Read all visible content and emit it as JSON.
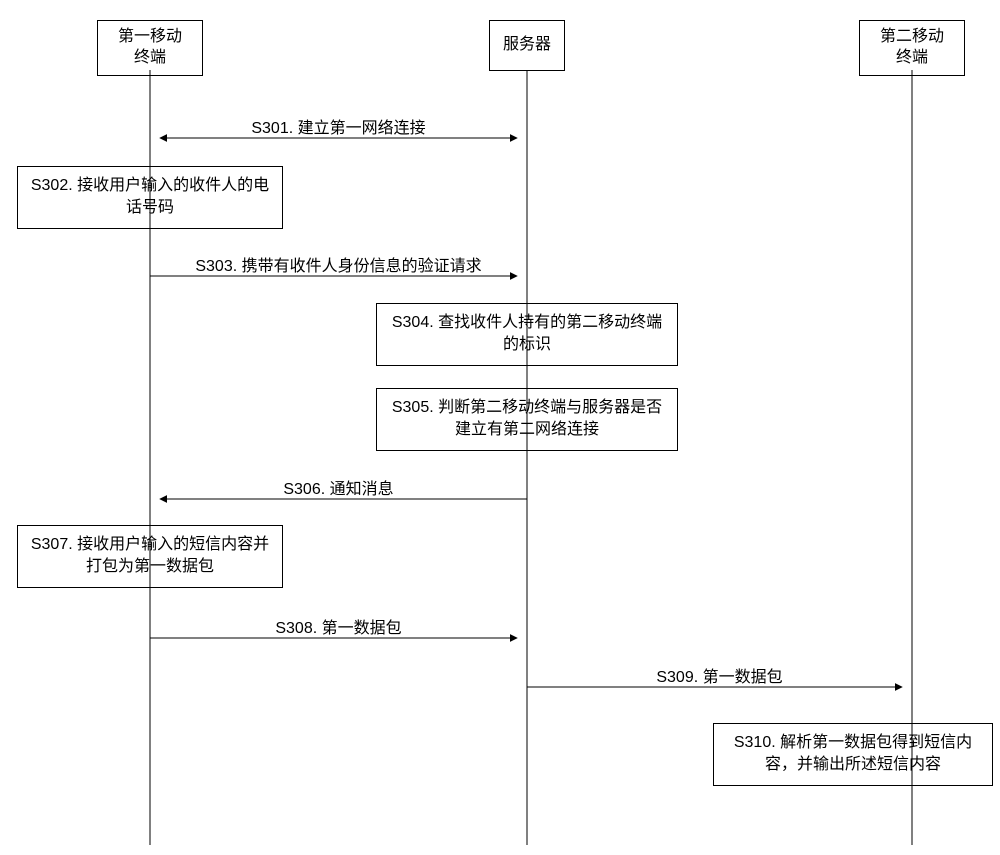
{
  "actors": {
    "a1": "第一移动\n终端",
    "a2": "服务器",
    "a3": "第二移动\n终端"
  },
  "messages": {
    "m301": "S301. 建立第一网络连接",
    "m303": "S303. 携带有收件人身份信息的验证请求",
    "m306": "S306. 通知消息",
    "m308": "S308. 第一数据包",
    "m309": "S309. 第一数据包"
  },
  "steps": {
    "s302": "S302. 接收用户输入的收件人的电话号码",
    "s304": "S304. 查找收件人持有的第二移动终端的标识",
    "s305": "S305. 判断第二移动终端与服务器是否建立有第二网络连接",
    "s307": "S307. 接收用户输入的短信内容并打包为第一数据包",
    "s310": "S310. 解析第一数据包得到短信内容，并输出所述短信内容"
  }
}
